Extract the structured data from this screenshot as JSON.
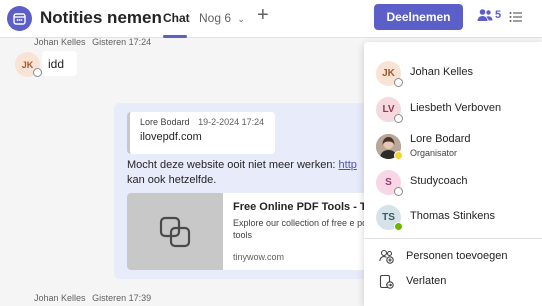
{
  "header": {
    "title": "Notities nemen",
    "tab_chat": "Chat",
    "tab_more": "Nog 6",
    "join_label": "Deelnemen",
    "people_count": "5",
    "accent": "#5b5fc7"
  },
  "chat": {
    "top_meta": {
      "author": "Johan Kelles",
      "time": "Gisteren 17:24"
    },
    "first_message": {
      "avatar_initials": "JK",
      "text": "idd"
    },
    "my_message": {
      "quote": {
        "author": "Lore Bodard",
        "date": "19-2-2024 17:24",
        "text": "ilovepdf.com"
      },
      "text_before_link": "Mocht deze website ooit niet meer werken: ",
      "link_text": "http",
      "text_after_link": "kan ook hetzelfde.",
      "link_card": {
        "title": "Free Online PDF Tools - Ti",
        "description": "Explore our collection of free e pdf tools",
        "domain": "tinywow.com"
      }
    },
    "bottom_meta": {
      "author": "Johan Kelles",
      "time": "Gisteren 17:39"
    }
  },
  "participants_panel": {
    "participants": [
      {
        "initials": "JK",
        "name": "Johan Kelles",
        "role": "",
        "avatar_bg": "#f9e3d5",
        "avatar_fg": "#a15a2d",
        "status": "offline"
      },
      {
        "initials": "LV",
        "name": "Liesbeth Verboven",
        "role": "",
        "avatar_bg": "#f5d9de",
        "avatar_fg": "#8f3a4c",
        "status": "offline"
      },
      {
        "initials": "",
        "name": "Lore Bodard",
        "role": "Organisator",
        "avatar_bg": "#8d6e63",
        "avatar_fg": "#ffffff",
        "status": "away"
      },
      {
        "initials": "S",
        "name": "Studycoach",
        "role": "",
        "avatar_bg": "#f7d6e6",
        "avatar_fg": "#a03a73",
        "status": "offline"
      },
      {
        "initials": "TS",
        "name": "Thomas Stinkens",
        "role": "",
        "avatar_bg": "#d5e2e8",
        "avatar_fg": "#3b5766",
        "status": "available"
      }
    ],
    "actions": [
      {
        "label": "Personen toevoegen",
        "icon": "add-people-icon"
      },
      {
        "label": "Verlaten",
        "icon": "leave-icon"
      }
    ]
  }
}
